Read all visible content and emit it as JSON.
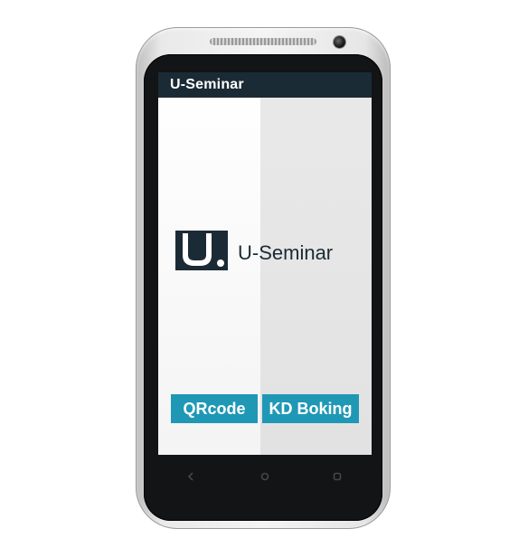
{
  "app": {
    "title": "U-Seminar"
  },
  "splash": {
    "logo_text": "U-Seminar",
    "logo_icon": "u-seminar-logo-icon"
  },
  "actions": {
    "qrcode_label": "QRcode",
    "kd_booking_label": "KD Boking"
  },
  "navigation": {
    "back_icon": "back-icon",
    "home_icon": "home-icon",
    "recent_icon": "recent-apps-icon"
  },
  "colors": {
    "titlebar": "#1b2b35",
    "button": "#1f98b6",
    "logo": "#1b2b35"
  }
}
